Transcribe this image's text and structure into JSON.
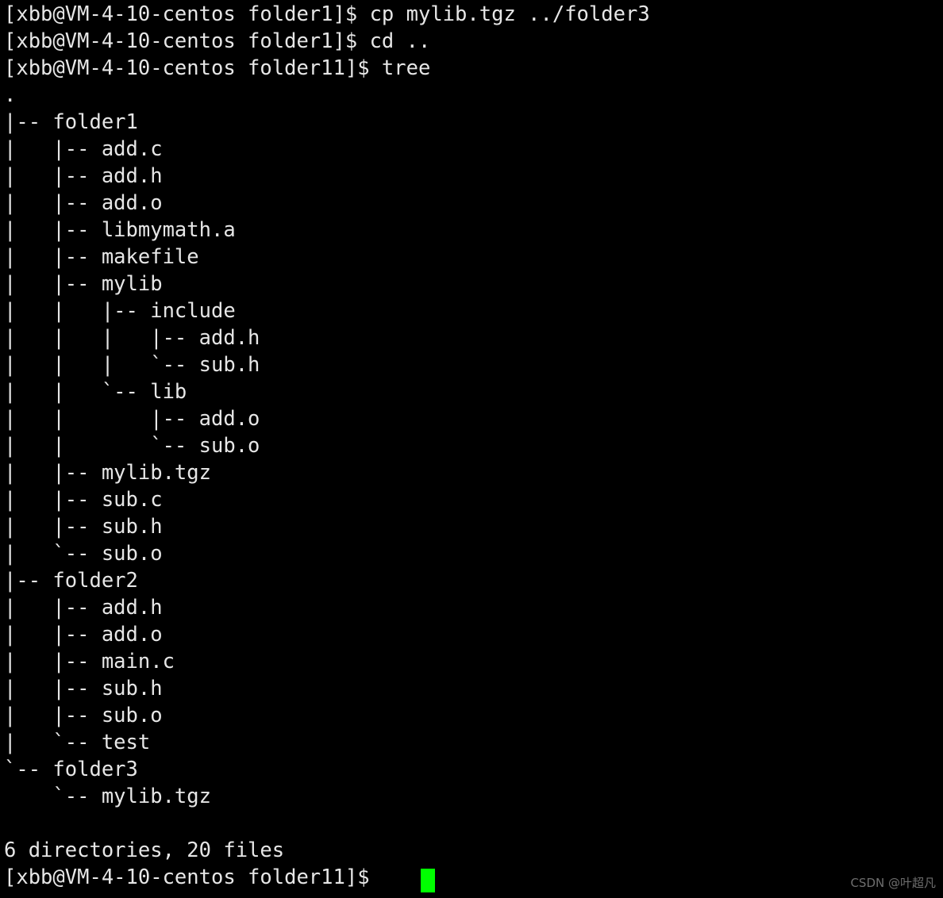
{
  "terminal": {
    "background_color": "#000000",
    "foreground_color": "#e6e6e6",
    "cursor_color": "#00ff00",
    "prompt_user_host_folder1": "[xbb@VM-4-10-centos folder1]$ ",
    "prompt_user_host_folder11": "[xbb@VM-4-10-centos folder11]$ ",
    "lines": [
      "[xbb@VM-4-10-centos folder1]$ cp mylib.tgz ../folder3",
      "[xbb@VM-4-10-centos folder1]$ cd ..",
      "[xbb@VM-4-10-centos folder11]$ tree",
      ".",
      "|-- folder1",
      "|   |-- add.c",
      "|   |-- add.h",
      "|   |-- add.o",
      "|   |-- libmymath.a",
      "|   |-- makefile",
      "|   |-- mylib",
      "|   |   |-- include",
      "|   |   |   |-- add.h",
      "|   |   |   `-- sub.h",
      "|   |   `-- lib",
      "|   |       |-- add.o",
      "|   |       `-- sub.o",
      "|   |-- mylib.tgz",
      "|   |-- sub.c",
      "|   |-- sub.h",
      "|   `-- sub.o",
      "|-- folder2",
      "|   |-- add.h",
      "|   |-- add.o",
      "|   |-- main.c",
      "|   |-- sub.h",
      "|   |-- sub.o",
      "|   `-- test",
      "`-- folder3",
      "    `-- mylib.tgz",
      "",
      "6 directories, 20 files",
      "[xbb@VM-4-10-centos folder11]$ "
    ],
    "commands": [
      "cp mylib.tgz ../folder3",
      "cd ..",
      "tree"
    ],
    "summary": "6 directories, 20 files"
  },
  "tree_output": {
    "root": ".",
    "entries": [
      {
        "name": "folder1",
        "type": "directory",
        "depth": 1
      },
      {
        "name": "add.c",
        "type": "file",
        "depth": 2
      },
      {
        "name": "add.h",
        "type": "file",
        "depth": 2
      },
      {
        "name": "add.o",
        "type": "file",
        "depth": 2
      },
      {
        "name": "libmymath.a",
        "type": "file",
        "depth": 2
      },
      {
        "name": "makefile",
        "type": "file",
        "depth": 2
      },
      {
        "name": "mylib",
        "type": "directory",
        "depth": 2
      },
      {
        "name": "include",
        "type": "directory",
        "depth": 3
      },
      {
        "name": "add.h",
        "type": "file",
        "depth": 4
      },
      {
        "name": "sub.h",
        "type": "file",
        "depth": 4
      },
      {
        "name": "lib",
        "type": "directory",
        "depth": 3
      },
      {
        "name": "add.o",
        "type": "file",
        "depth": 4
      },
      {
        "name": "sub.o",
        "type": "file",
        "depth": 4
      },
      {
        "name": "mylib.tgz",
        "type": "file",
        "depth": 2
      },
      {
        "name": "sub.c",
        "type": "file",
        "depth": 2
      },
      {
        "name": "sub.h",
        "type": "file",
        "depth": 2
      },
      {
        "name": "sub.o",
        "type": "file",
        "depth": 2
      },
      {
        "name": "folder2",
        "type": "directory",
        "depth": 1
      },
      {
        "name": "add.h",
        "type": "file",
        "depth": 2
      },
      {
        "name": "add.o",
        "type": "file",
        "depth": 2
      },
      {
        "name": "main.c",
        "type": "file",
        "depth": 2
      },
      {
        "name": "sub.h",
        "type": "file",
        "depth": 2
      },
      {
        "name": "sub.o",
        "type": "file",
        "depth": 2
      },
      {
        "name": "test",
        "type": "file",
        "depth": 2
      },
      {
        "name": "folder3",
        "type": "directory",
        "depth": 1
      },
      {
        "name": "mylib.tgz",
        "type": "file",
        "depth": 2
      }
    ],
    "directory_count": 6,
    "file_count": 20
  },
  "watermark": {
    "text": "CSDN @叶超凡",
    "color": "#6e6e6e"
  }
}
